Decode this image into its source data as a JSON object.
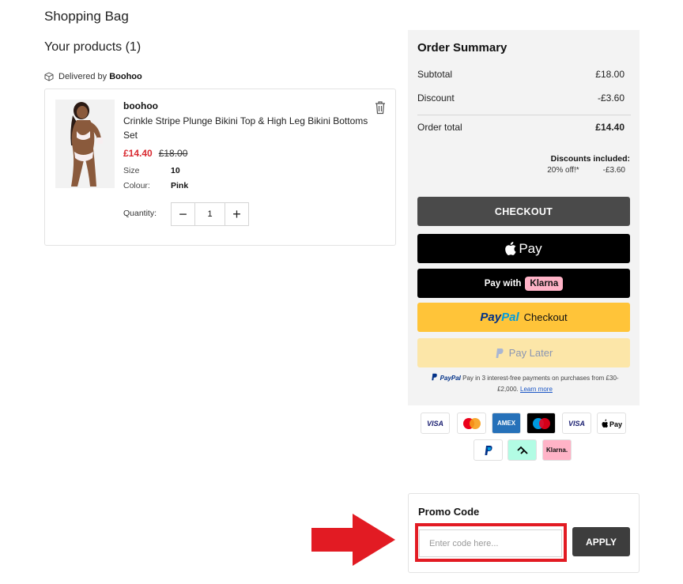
{
  "page": {
    "title": "Shopping Bag",
    "products_heading": "Your products (1)"
  },
  "delivery": {
    "prefix": "Delivered by",
    "seller": "Boohoo"
  },
  "product": {
    "brand": "boohoo",
    "name": "Crinkle Stripe Plunge Bikini Top & High Leg Bikini Bottoms Set",
    "price_now": "£14.40",
    "price_was": "£18.00",
    "size_label": "Size",
    "size_value": "10",
    "colour_label": "Colour:",
    "colour_value": "Pink",
    "quantity_label": "Quantity:",
    "quantity": "1",
    "minus": "−",
    "plus": "+"
  },
  "summary": {
    "title": "Order Summary",
    "subtotal_label": "Subtotal",
    "subtotal": "£18.00",
    "discount_label": "Discount",
    "discount": "-£3.60",
    "total_label": "Order total",
    "total": "£14.40",
    "discounts_included": "Discounts included:",
    "discount_detail_label": "20% off!*",
    "discount_detail_value": "-£3.60"
  },
  "payments": {
    "checkout": "CHECKOUT",
    "apple_pay": "Pay",
    "klarna_prefix": "Pay with",
    "klarna_badge": "Klarna",
    "paypal_pay": "Pay",
    "paypal_pal": "Pal",
    "paypal_checkout": "Checkout",
    "pay_later": "Pay Later",
    "paypal_note_brand": "PayPal",
    "paypal_note": "Pay in 3 interest-free payments on purchases from £30-£2,000.",
    "learn_more": "Learn more"
  },
  "card_icons": [
    "VISA",
    "Mastercard",
    "AMEX",
    "Maestro",
    "VISA",
    "Apple Pay",
    "PayPal",
    "Clearpay",
    "Klarna."
  ],
  "promo": {
    "title": "Promo Code",
    "placeholder": "Enter code here...",
    "apply": "APPLY"
  },
  "colors": {
    "sale_red": "#d8282f",
    "highlight_red": "#e21b23",
    "checkout_grey": "#4a4a4a",
    "paypal_yellow": "#ffc439",
    "klarna_pink": "#ffb3c7"
  }
}
